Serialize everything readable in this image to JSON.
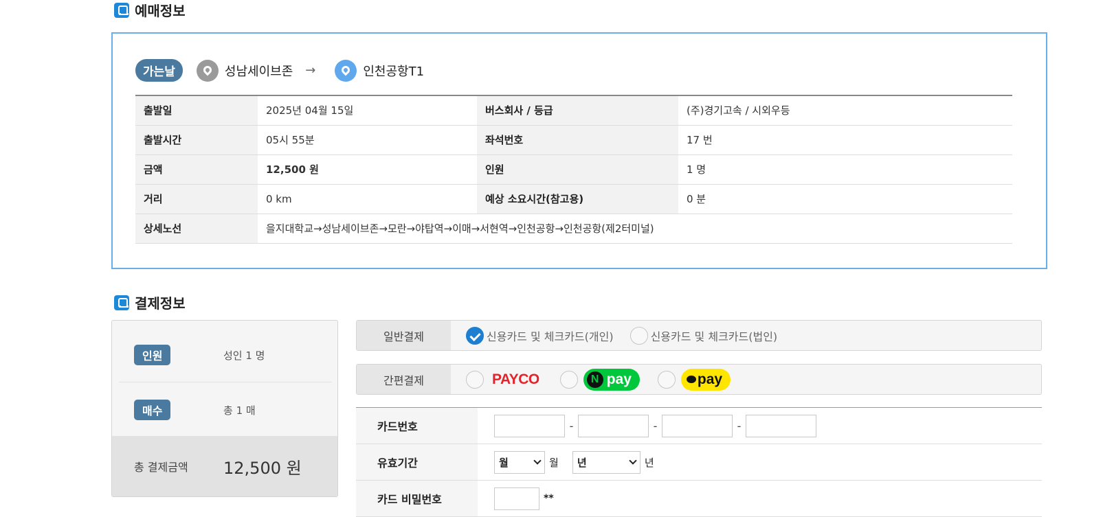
{
  "sections": {
    "booking_title": "예매정보",
    "payment_title": "결제정보"
  },
  "route": {
    "badge": "가는날",
    "from": "성남세이브존",
    "arrow": "→",
    "to": "인천공항T1"
  },
  "booking_table": {
    "r1": {
      "l1": "출발일",
      "v1": "2025년 04월 15일",
      "l2": "버스회사 / 등급",
      "v2": "(주)경기고속 / 시외우등"
    },
    "r2": {
      "l1": "출발시간",
      "v1": "05시 55분",
      "l2": "좌석번호",
      "v2": "17 번"
    },
    "r3": {
      "l1": "금액",
      "v1": "12,500 원",
      "l2": "인원",
      "v2": "1 명"
    },
    "r4": {
      "l1": "거리",
      "v1": "0 km",
      "l2": "예상 소요시간(참고용)",
      "v2": "0 분"
    },
    "r5": {
      "l1": "상세노선",
      "v1": "을지대학교→성남세이브존→모란→야탑역→이매→서현역→인천공항→인천공항(제2터미널)"
    }
  },
  "summary": {
    "people_badge": "인원",
    "people_value": "성인 1 명",
    "count_badge": "매수",
    "count_value": "총 1 매",
    "total_label": "총 결제금액",
    "total_value": "12,500 원"
  },
  "payment": {
    "general_label": "일반결제",
    "general_option_personal": "신용카드 및 체크카드(개인)",
    "general_option_corporate": "신용카드 및 체크카드(법인)",
    "general_selected": "신용카드 및 체크카드(개인)",
    "easy_label": "간편결제",
    "payco_label": "PAYCO",
    "npay_n": "N",
    "npay_label": "pay",
    "kpay_label": "pay"
  },
  "card_form": {
    "card_number_label": "카드번호",
    "dash": "-",
    "expiry_label": "유효기간",
    "month_select": "월",
    "month_unit": "월",
    "year_select": "년",
    "year_unit": "년",
    "password_label": "카드 비밀번호",
    "password_suffix": "**"
  },
  "colors": {
    "accent_blue": "#1e7fd0",
    "badge_blue": "#4a7aa0",
    "payco_red": "#e4232a",
    "npay_green": "#00c73c",
    "kpay_yellow": "#ffe500"
  }
}
